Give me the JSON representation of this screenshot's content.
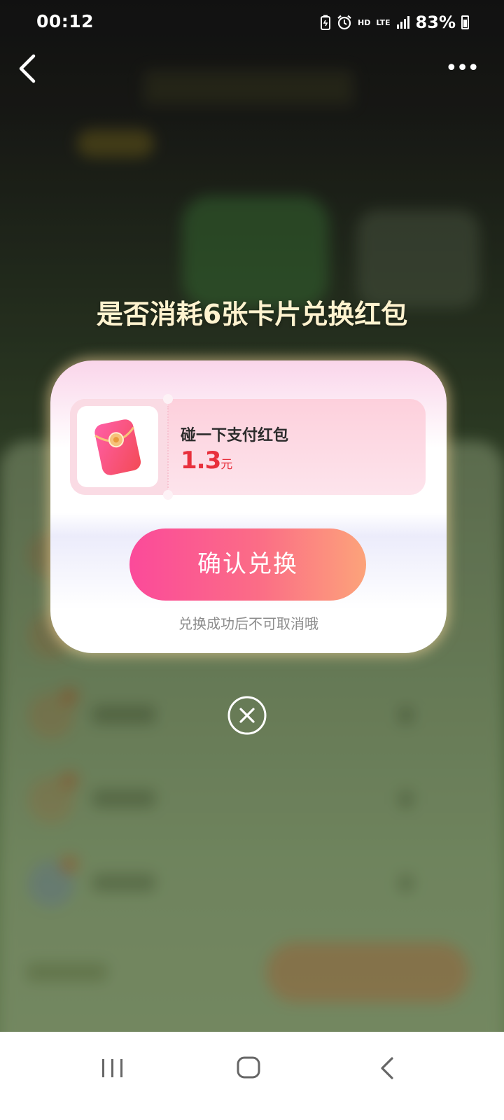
{
  "status_bar": {
    "time": "00:12",
    "hd": "HD",
    "network": "LTE",
    "battery": "83%"
  },
  "nav": {
    "back_icon": "chevron-left-icon",
    "more_label": "•••"
  },
  "dialog": {
    "title": "是否消耗6张卡片兑换红包",
    "coupon": {
      "name": "碰一下支付红包",
      "amount": "1.3",
      "unit": "元"
    },
    "confirm_label": "确认兑换",
    "note": "兑换成功后不可取消哦",
    "close_icon": "close-circle-icon"
  },
  "system_nav": {
    "recent_icon": "recent-apps-icon",
    "home_icon": "home-icon",
    "back_icon": "back-icon"
  },
  "colors": {
    "title": "#fff3cf",
    "amount": "#e8303c",
    "button_start": "#fb4a9a",
    "button_end": "#fca37a"
  }
}
